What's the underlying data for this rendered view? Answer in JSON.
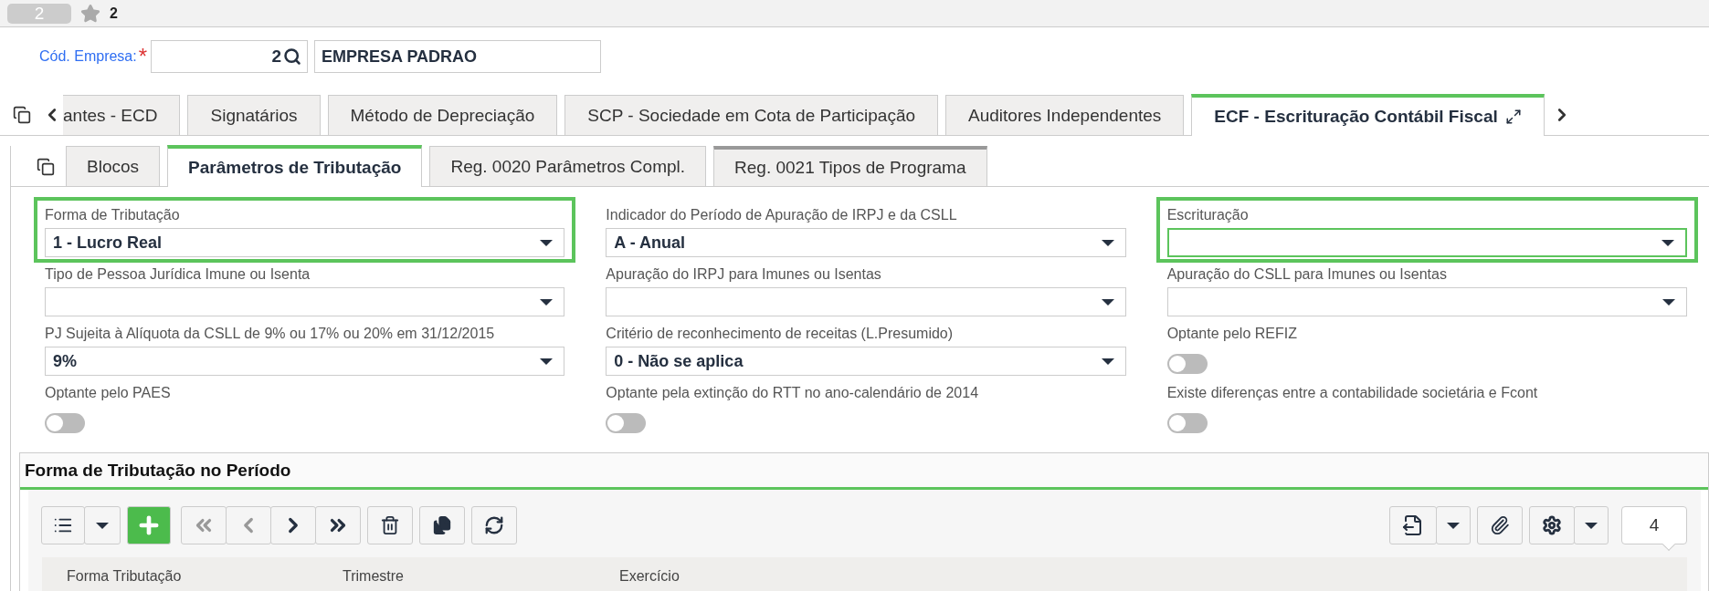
{
  "top_bar": {
    "badge": "2",
    "favorites": "2"
  },
  "company": {
    "label": "Cód. Empresa:",
    "required_mark": "*",
    "code": "2",
    "name": "EMPRESA PADRAO"
  },
  "tabs": [
    {
      "label": "antes - ECD",
      "selected": false
    },
    {
      "label": "Signatários",
      "selected": false
    },
    {
      "label": "Método de Depreciação",
      "selected": false
    },
    {
      "label": "SCP - Sociedade em Cota de Participação",
      "selected": false
    },
    {
      "label": "Auditores Independentes",
      "selected": false
    },
    {
      "label": "ECF - Escrituração Contábil Fiscal",
      "selected": true
    }
  ],
  "subtabs": [
    {
      "label": "Blocos",
      "selected": false,
      "hovered": false
    },
    {
      "label": "Parâmetros de Tributação",
      "selected": true,
      "hovered": false
    },
    {
      "label": "Reg. 0020 Parâmetros Compl.",
      "selected": false,
      "hovered": false
    },
    {
      "label": "Reg. 0021 Tipos de Programa",
      "selected": false,
      "hovered": true
    }
  ],
  "fields": [
    {
      "kind": "select",
      "label": "Forma de Tributação",
      "value": "1 - Lucro Real",
      "highlighted": true,
      "focused": false
    },
    {
      "kind": "select",
      "label": "Indicador do Período de Apuração de IRPJ e da CSLL",
      "value": "A - Anual",
      "focused": false
    },
    {
      "kind": "select",
      "label": "Escrituração",
      "highlighted": true,
      "focused": true
    },
    {
      "kind": "select",
      "label": "Tipo de Pessoa Jurídica Imune ou Isenta",
      "focused": false
    },
    {
      "kind": "select",
      "label": "Apuração do IRPJ para Imunes ou Isentas",
      "focused": false
    },
    {
      "kind": "select",
      "label": "Apuração do CSLL para Imunes ou Isentas",
      "focused": false
    },
    {
      "kind": "select",
      "label": "PJ Sujeita à Alíquota da CSLL de 9% ou 17% ou 20% em 31/12/2015",
      "value": "9%",
      "focused": false
    },
    {
      "kind": "select",
      "label": "Critério de reconhecimento de receitas (L.Presumido)",
      "value": "0 - Não se aplica",
      "focused": false
    },
    {
      "kind": "toggle",
      "label": "Optante pelo REFIZ",
      "on": false
    },
    {
      "kind": "toggle",
      "label": "Optante pelo PAES",
      "on": false
    },
    {
      "kind": "toggle",
      "label": "Optante pela extinção do RTT no ano-calendário de 2014",
      "on": false
    },
    {
      "kind": "toggle",
      "label": "Existe diferenças entre a contabilidade societária e Fcont",
      "on": false
    }
  ],
  "section": {
    "title": "Forma de Tributação no Período",
    "nav_buttons": [
      {
        "disabled": true
      },
      {
        "disabled": true
      },
      {
        "disabled": false
      },
      {
        "disabled": false
      }
    ],
    "record_count": "4",
    "table": {
      "columns": [
        "Forma Tributação",
        "Trimestre",
        "Exercício"
      ]
    }
  }
}
